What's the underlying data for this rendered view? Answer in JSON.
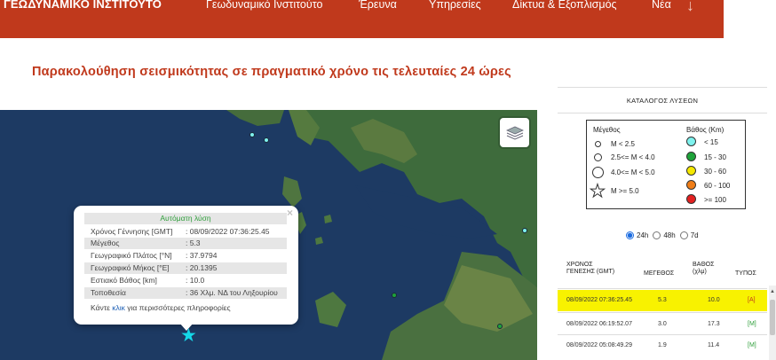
{
  "header": {
    "brand": "ΓΕΩΔΥΝΑΜΙΚΟ ΙΝΣΤΙΤΟΥΤΟ",
    "nav": [
      "Γεωδυναμικό Ινστιτούτο",
      "Έρευνα",
      "Υπηρεσίες",
      "Δίκτυα & Εξοπλισμός",
      "Νέα"
    ],
    "arrow": "↓",
    "bg_color": "#c0391c"
  },
  "page_title": "Παρακολούθηση σεισμικότητας σε πραγματικό χρόνο τις τελευταίες 24 ώρες",
  "popup": {
    "header": "Αυτόματη λύση",
    "close": "×",
    "rows": [
      {
        "label": "Χρόνος Γέννησης [GMT]",
        "value": ": 08/09/2022 07:36:25.45"
      },
      {
        "label": "Μέγεθος",
        "value": ": 5.3"
      },
      {
        "label": "Γεωγραφικό Πλάτος [°N]",
        "value": ": 37.9794"
      },
      {
        "label": "Γεωγραφικό Μήκος [°E]",
        "value": ": 20.1395"
      },
      {
        "label": "Εστιακό Βάθος [km]",
        "value": ": 10.0"
      },
      {
        "label": "Τοποθεσία",
        "value": ": 36 Χλμ. ΝΔ του Ληξουρίου"
      }
    ],
    "footer_pre": "Κάντε ",
    "footer_link": "κλικ",
    "footer_post": " για περισσότερες πληροφορίες"
  },
  "map": {
    "layers_icon": "layers-icon",
    "sea_color": "#1d3a63",
    "event_star_color": "#14d8e8"
  },
  "catalog": {
    "title": "ΚΑΤΑΛΟΓΟΣ ΛΥΣΕΩΝ",
    "legend": {
      "mag_header": "Μέγεθος",
      "depth_header": "Βάθος (Km)",
      "magnitudes": [
        "M < 2.5",
        "2.5<= M < 4.0",
        "4.0<= M < 5.0",
        "M >= 5.0"
      ],
      "depths": [
        {
          "label": "< 15",
          "color": "#7ef2ee"
        },
        {
          "label": "15 - 30",
          "color": "#1ea33a"
        },
        {
          "label": "30 - 60",
          "color": "#f5e800"
        },
        {
          "label": "60 - 100",
          "color": "#ef7d17"
        },
        {
          "label": ">= 100",
          "color": "#e32020"
        }
      ]
    },
    "periods": [
      {
        "label": "24h",
        "selected": true
      },
      {
        "label": "48h",
        "selected": false
      },
      {
        "label": "7d",
        "selected": false
      }
    ],
    "columns": {
      "time_1": "ΧΡΟΝΟΣ",
      "time_2": "ΓΕΝΕΣΗΣ (GMT)",
      "mag": "ΜΕΓΕΘΟΣ",
      "depth_1": "ΒΑΘΟΣ",
      "depth_2": "(χλμ)",
      "type": "ΤΥΠΟΣ"
    },
    "rows": [
      {
        "time": "08/09/2022 07:36:25.45",
        "mag": "5.3",
        "depth": "10.0",
        "type": "[A]"
      },
      {
        "time": "08/09/2022 06:19:52.07",
        "mag": "3.0",
        "depth": "17.3",
        "type": "[M]"
      },
      {
        "time": "08/09/2022 05:08:49.29",
        "mag": "1.9",
        "depth": "11.4",
        "type": "[M]"
      }
    ]
  }
}
